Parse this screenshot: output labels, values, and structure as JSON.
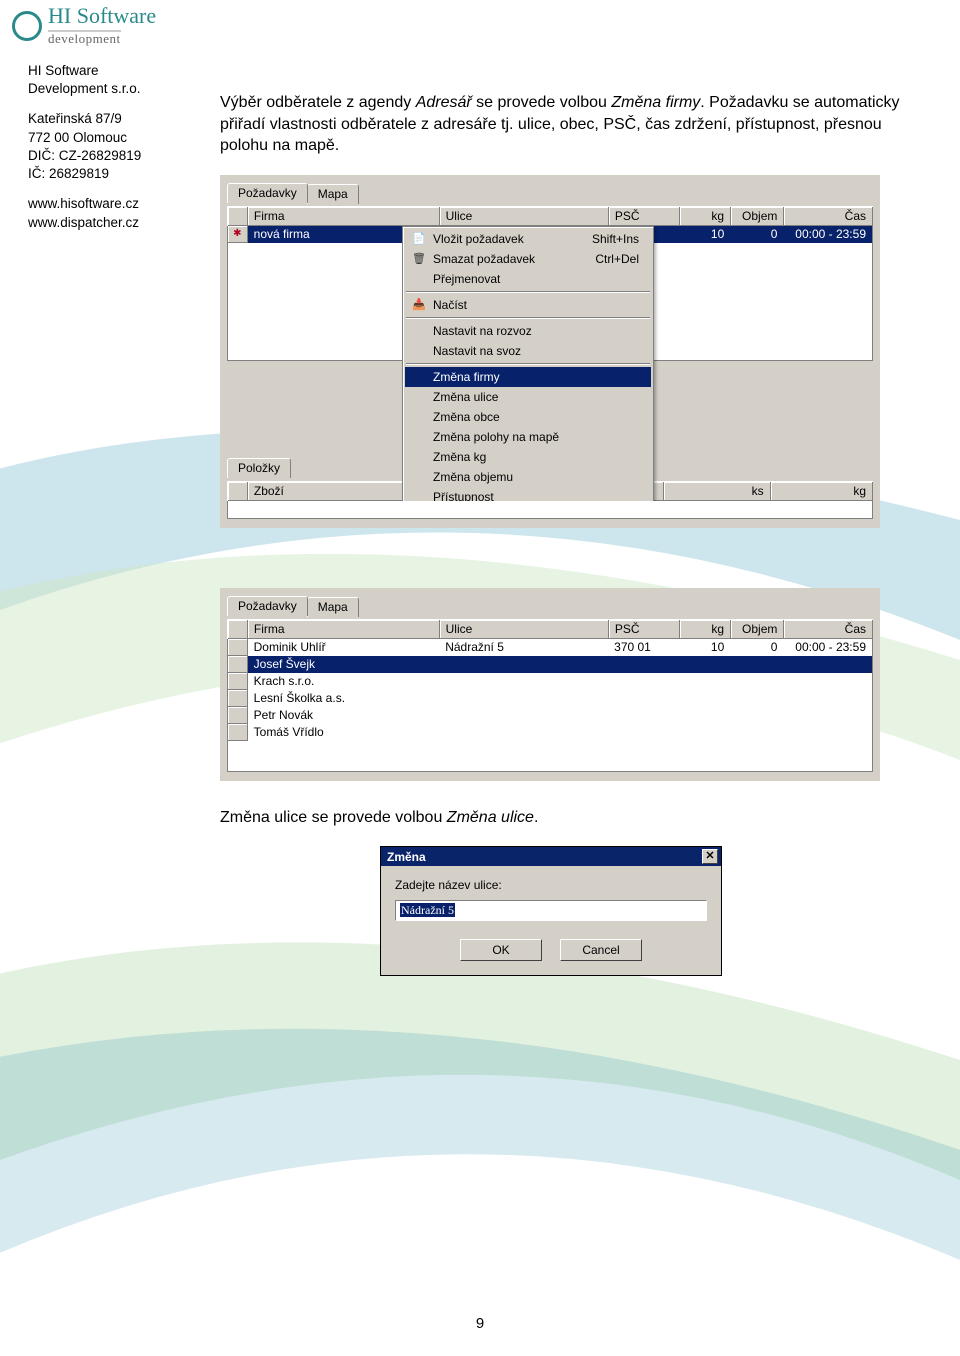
{
  "logo": {
    "line1": "HI Software",
    "line2": "development"
  },
  "sidebar": {
    "company1": "HI Software",
    "company2": "Development s.r.o.",
    "addr1": "Kateřinská 87/9",
    "addr2": "772 00 Olomouc",
    "dic": "DIČ: CZ-26829819",
    "ic": "IČ: 26829819",
    "url1": "www.hisoftware.cz",
    "url2": "www.dispatcher.cz"
  },
  "para1": {
    "p1a": "Výběr odběratele z agendy ",
    "p1b": "Adresář",
    "p1c": " se provede volbou ",
    "p1d": "Změna firmy",
    "p1e": ". Požadavku se automaticky přiřadí vlastnosti odběratele z adresáře tj. ulice, obec, PSČ, čas zdržení, přístupnost, přesnou polohu na mapě."
  },
  "panel1": {
    "tabs": {
      "t1": "Požadavky",
      "t2": "Mapa"
    },
    "headers": {
      "firma": "Firma",
      "ulice": "Ulice",
      "psc": "PSČ",
      "kg": "kg",
      "objem": "Objem",
      "cas": "Čas"
    },
    "row": {
      "lead": "✱",
      "firma": "nová firma",
      "ulice": "",
      "psc": "",
      "kg": "10",
      "objem": "0",
      "cas": "00:00 - 23:59"
    },
    "menu": {
      "insert": "Vložit požadavek",
      "insert_acc": "Shift+Ins",
      "delete": "Smazat požadavek",
      "delete_acc": "Ctrl+Del",
      "rename": "Přejmenovat",
      "load": "Načíst",
      "set_rozvoz": "Nastavit na rozvoz",
      "set_svoz": "Nastavit na svoz",
      "chg_firma": "Změna firmy",
      "chg_ulice": "Změna ulice",
      "chg_obec": "Změna obce",
      "chg_poloha": "Změna polohy na mapě",
      "chg_kg": "Změna kg",
      "chg_objem": "Změna objemu",
      "pristup": "Přístupnost"
    },
    "subtabs": {
      "polozky": "Položky"
    },
    "subheaders": {
      "zbozi": "Zboží",
      "ks": "ks",
      "kg": "kg"
    }
  },
  "panel2": {
    "tabs": {
      "t1": "Požadavky",
      "t2": "Mapa"
    },
    "headers": {
      "firma": "Firma",
      "ulice": "Ulice",
      "psc": "PSČ",
      "kg": "kg",
      "objem": "Objem",
      "cas": "Čas"
    },
    "rows": [
      {
        "firma": "Dominik Uhlíř",
        "ulice": "Nádražní 5",
        "psc": "370 01",
        "kg": "10",
        "objem": "0",
        "cas": "00:00 - 23:59"
      },
      {
        "firma": "Josef Švejk"
      },
      {
        "firma": "Krach s.r.o."
      },
      {
        "firma": "Lesní Školka a.s."
      },
      {
        "firma": "Petr Novák"
      },
      {
        "firma": "Tomáš Vřídlo"
      }
    ],
    "selected_index": 1
  },
  "para2": {
    "a": "Změna ulice se provede volbou ",
    "b": "Změna ulice",
    "c": "."
  },
  "dialog": {
    "title": "Změna",
    "label": "Zadejte název ulice:",
    "value": "Nádražní 5",
    "ok": "OK",
    "cancel": "Cancel"
  },
  "page_number": "9"
}
